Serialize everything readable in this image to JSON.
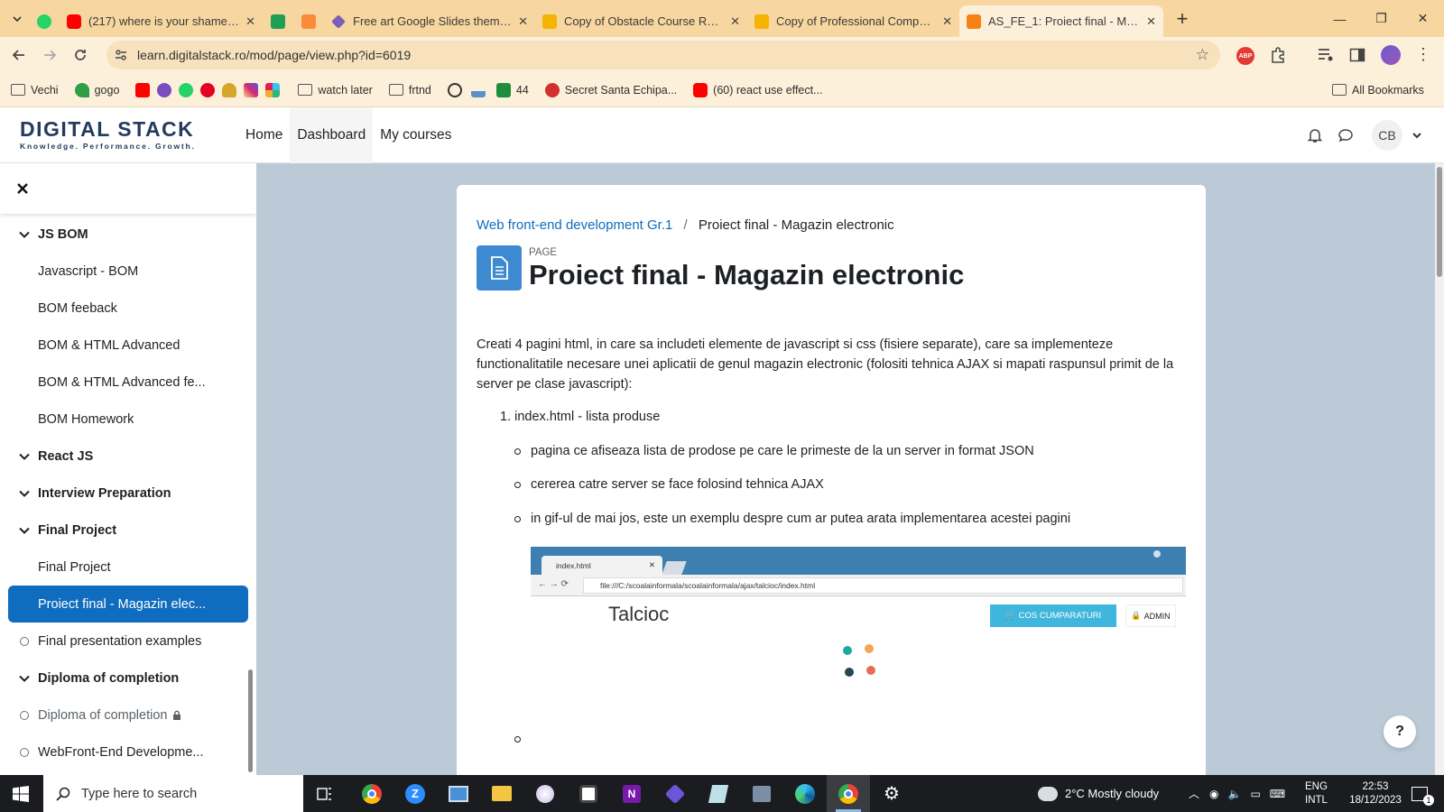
{
  "browser": {
    "tabs": [
      {
        "title": "(217) where is your shame - You",
        "favicon": "youtube-icon"
      },
      {
        "title": "Free art Google Slides themes a",
        "favicon": "slidesgo-icon"
      },
      {
        "title": "Copy of Obstacle Course Race F",
        "favicon": "google-slides-icon"
      },
      {
        "title": "Copy of Professional Company",
        "favicon": "google-slides-icon"
      },
      {
        "title": "AS_FE_1: Proiect final - Magazin",
        "favicon": "moodle-icon",
        "active": true
      }
    ],
    "url": "learn.digitalstack.ro/mod/page/view.php?id=6019",
    "bookmarks": [
      "Vechi",
      "gogo",
      "watch later",
      "frtnd",
      "44",
      "Secret Santa Echipa...",
      "(60) react use effect..."
    ],
    "all_bookmarks": "All Bookmarks",
    "ext_badge": "ABP"
  },
  "site": {
    "logo_main": "DIGITAL STACK",
    "logo_tagline": "Knowledge. Performance. Growth.",
    "nav": [
      "Home",
      "Dashboard",
      "My courses"
    ],
    "avatar_initials": "CB"
  },
  "drawer": {
    "items": [
      {
        "type": "section",
        "label": "JS BOM"
      },
      {
        "type": "activity",
        "label": "Javascript - BOM"
      },
      {
        "type": "activity",
        "label": "BOM feeback"
      },
      {
        "type": "activity",
        "label": "BOM & HTML Advanced"
      },
      {
        "type": "activity",
        "label": "BOM & HTML Advanced fe..."
      },
      {
        "type": "activity",
        "label": "BOM Homework"
      },
      {
        "type": "section",
        "label": "React JS"
      },
      {
        "type": "section",
        "label": "Interview Preparation"
      },
      {
        "type": "section",
        "label": "Final Project"
      },
      {
        "type": "activity",
        "label": "Final Project"
      },
      {
        "type": "current",
        "label": "Proiect final - Magazin elec..."
      },
      {
        "type": "circle",
        "label": "Final presentation examples"
      },
      {
        "type": "section",
        "label": "Diploma of completion"
      },
      {
        "type": "circle-locked",
        "label": "Diploma of completion"
      },
      {
        "type": "circle",
        "label": "WebFront-End Developme..."
      }
    ]
  },
  "content": {
    "breadcrumb": [
      "Web front-end development Gr.1",
      "Proiect final - Magazin electronic"
    ],
    "page_label": "PAGE",
    "title": "Proiect final - Magazin electronic",
    "intro": "Creati 4 pagini html, in care sa includeti elemente de javascript si css (fisiere separate), care sa implementeze functionalitatile necesare unei aplicatii de genul magazin electronic (folositi tehnica AJAX si mapati raspunsul primit de la server pe clase javascript):",
    "list_item_1": "1. index.html - lista produse",
    "bullets": [
      "pagina ce afiseaza lista de prodose pe care le primeste de la un server in format JSON",
      "cererea catre server se face folosind tehnica AJAX",
      "in gif-ul de mai jos, este un exemplu despre cum ar putea arata implementarea acestei pagini"
    ],
    "gif": {
      "tab_title": "index.html",
      "url": "file:///C:/scoalainformala/scoalainformala/ajax/talcioc/index.html",
      "brand": "Talcioc",
      "cart_button": "COS CUMPARATURI",
      "admin_button": "ADMIN"
    },
    "help": "?"
  },
  "taskbar": {
    "search_placeholder": "Type here to search",
    "weather": "2°C  Mostly cloudy",
    "lang": "ENG",
    "layout": "INTL",
    "time": "22:53",
    "date": "18/12/2023",
    "notif_count": "1"
  },
  "colors": {
    "chrome_tabstrip": "#f7d69f",
    "moodle_primary": "#0f6cbf",
    "page_bg": "#bccad7"
  }
}
